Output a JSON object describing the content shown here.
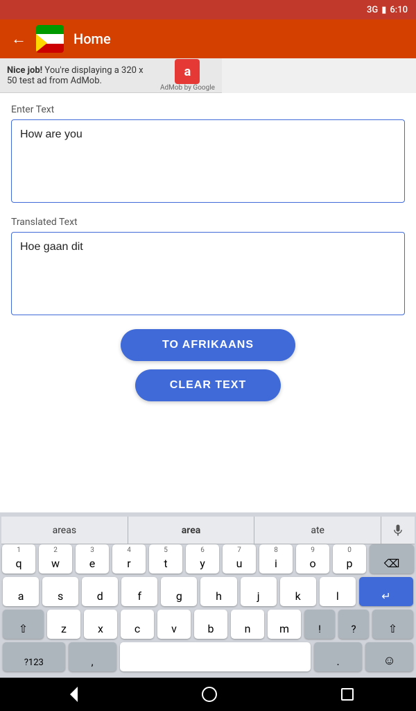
{
  "status_bar": {
    "signal": "3G",
    "battery": "🔋",
    "time": "6:10"
  },
  "app_bar": {
    "title": "Home",
    "back_label": "←"
  },
  "ad": {
    "text_bold": "Nice job!",
    "text_normal": " You're displaying a 320 x 50 test ad from AdMob.",
    "logo_letter": "a",
    "by_google": "AdMob by Google"
  },
  "enter_text_label": "Enter Text",
  "input_text": "How are you",
  "translated_text_label": "Translated Text",
  "translated_text": "Hoe gaan dit",
  "buttons": {
    "translate": "TO AFRIKAANS",
    "clear": "CLEAR TEXT"
  },
  "keyboard": {
    "suggestions": [
      "areas",
      "area",
      "ate"
    ],
    "rows": [
      {
        "keys": [
          {
            "label": "q",
            "num": "1"
          },
          {
            "label": "w",
            "num": "2"
          },
          {
            "label": "e",
            "num": "3"
          },
          {
            "label": "r",
            "num": "4"
          },
          {
            "label": "t",
            "num": "5"
          },
          {
            "label": "y",
            "num": "6"
          },
          {
            "label": "u",
            "num": "7"
          },
          {
            "label": "i",
            "num": "8"
          },
          {
            "label": "o",
            "num": "9"
          },
          {
            "label": "p",
            "num": "0"
          }
        ]
      },
      {
        "keys": [
          {
            "label": "a"
          },
          {
            "label": "s"
          },
          {
            "label": "d"
          },
          {
            "label": "f"
          },
          {
            "label": "g"
          },
          {
            "label": "h"
          },
          {
            "label": "j"
          },
          {
            "label": "k"
          },
          {
            "label": "l"
          }
        ]
      },
      {
        "keys": [
          {
            "label": "z"
          },
          {
            "label": "x"
          },
          {
            "label": "c"
          },
          {
            "label": "v"
          },
          {
            "label": "b"
          },
          {
            "label": "n"
          },
          {
            "label": "m"
          }
        ]
      }
    ],
    "special": {
      "backspace": "⌫",
      "shift": "⇧",
      "enter_symbol": "↵",
      "num": "?123",
      "comma": ",",
      "period": ".",
      "emoji": "☺"
    }
  },
  "nav_bar": {
    "back": "▷",
    "home": "○",
    "recent": "□"
  }
}
